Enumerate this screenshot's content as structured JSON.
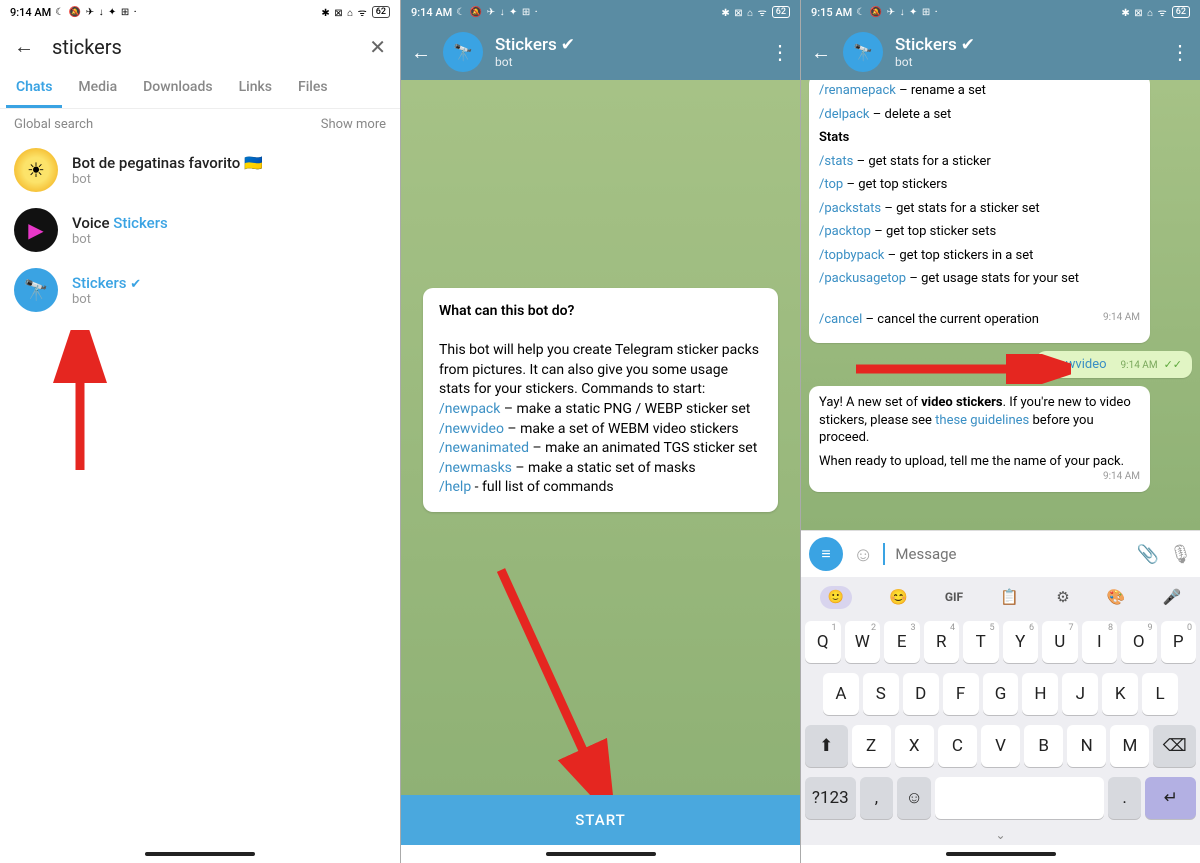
{
  "status": {
    "time1": "9:14 AM",
    "time2": "9:14 AM",
    "time3": "9:15 AM",
    "icons_left": "☾ 🔕 ✈ ↓ ✦ ⊞ ·",
    "icons_right": "✱ ⊠ ⌂ ᯤ",
    "battery": "62"
  },
  "screen1": {
    "search_value": "stickers",
    "tabs": [
      "Chats",
      "Media",
      "Downloads",
      "Links",
      "Files"
    ],
    "active_tab": 0,
    "section": "Global search",
    "show_more": "Show more",
    "results": [
      {
        "name_pre": "Bot de pegatinas favorito ",
        "flag": "🇺🇦",
        "sub": "bot",
        "avatar": "av-yellow",
        "highlight": false,
        "verified": false,
        "glyph": "☀"
      },
      {
        "name_pre": "Voice ",
        "name_hi": "Stickers",
        "sub": "bot",
        "avatar": "av-black",
        "verified": false,
        "glyph": "▶"
      },
      {
        "name_hi": "Stickers",
        "sub": "bot",
        "avatar": "av-blue",
        "verified": true,
        "glyph": "🔭"
      }
    ]
  },
  "chat_header": {
    "title": "Stickers",
    "subtitle": "bot"
  },
  "screen2": {
    "intro_title": "What can this bot do?",
    "intro_body_1": "This bot will help you create Telegram sticker packs from pictures. It can also give you some usage stats for your stickers. Commands to start:",
    "cmds": [
      {
        "c": "/newpack",
        "d": " – make a static PNG / WEBP sticker set"
      },
      {
        "c": "/newvideo",
        "d": " – make a set of WEBM video stickers"
      },
      {
        "c": "/newanimated",
        "d": " – make an animated TGS sticker set"
      },
      {
        "c": "/newmasks",
        "d": " – make a static set of masks"
      },
      {
        "c": "/help",
        "d": " - full list of commands"
      }
    ],
    "start": "START"
  },
  "screen3": {
    "top_msg": {
      "rename_c": "/renamepack",
      "rename_d": " – rename a set",
      "lines": [
        {
          "c": "/delpack",
          "d": " – delete a set"
        }
      ],
      "stats_header": "Stats",
      "stats": [
        {
          "c": "/stats",
          "d": " – get stats for a sticker"
        },
        {
          "c": "/top",
          "d": " – get top stickers"
        },
        {
          "c": "/packstats",
          "d": " – get stats for a sticker set"
        },
        {
          "c": "/packtop",
          "d": " – get top sticker sets"
        },
        {
          "c": "/topbypack",
          "d": " – get top stickers in a set"
        },
        {
          "c": "/packusagetop",
          "d": " – get usage stats for your set"
        }
      ],
      "cancel_c": "/cancel",
      "cancel_d": " – cancel the current operation",
      "time": "9:14 AM"
    },
    "out_msg": {
      "text": "/newvideo",
      "time": "9:14 AM"
    },
    "reply": {
      "pre": "Yay! A new set of ",
      "bold": "video stickers",
      "post1": ". If you're new to video stickers, please see ",
      "link": "these guidelines",
      "post2": " before you proceed.",
      "para2": "When ready to upload, tell me the name of your pack.",
      "time": "9:14 AM"
    },
    "input_placeholder": "Message",
    "kbd_toolbar": [
      "😊",
      "GIF",
      "📋",
      "⚙",
      "🎨",
      "🎤"
    ],
    "kbd_row1": [
      [
        "Q",
        "1"
      ],
      [
        "W",
        "2"
      ],
      [
        "E",
        "3"
      ],
      [
        "R",
        "4"
      ],
      [
        "T",
        "5"
      ],
      [
        "Y",
        "6"
      ],
      [
        "U",
        "7"
      ],
      [
        "I",
        "8"
      ],
      [
        "O",
        "9"
      ],
      [
        "P",
        "0"
      ]
    ],
    "kbd_row2": [
      "A",
      "S",
      "D",
      "F",
      "G",
      "H",
      "J",
      "K",
      "L"
    ],
    "kbd_row3": [
      "Z",
      "X",
      "C",
      "V",
      "B",
      "N",
      "M"
    ],
    "shift": "⬆",
    "backspace": "⌫",
    "sym": "?123",
    "comma": ",",
    "emoji": "☺",
    "period": ".",
    "enter": "↵"
  }
}
